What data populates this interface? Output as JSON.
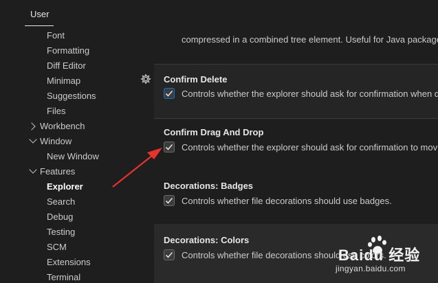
{
  "tab": {
    "label": "User"
  },
  "sidebar": {
    "items": [
      {
        "label": "Font"
      },
      {
        "label": "Formatting"
      },
      {
        "label": "Diff Editor"
      },
      {
        "label": "Minimap"
      },
      {
        "label": "Suggestions"
      },
      {
        "label": "Files"
      },
      {
        "label": "Workbench",
        "expandable": true,
        "expanded": false
      },
      {
        "label": "Window",
        "expandable": true,
        "expanded": true
      },
      {
        "label": "New Window"
      },
      {
        "label": "Features",
        "expandable": true,
        "expanded": true
      },
      {
        "label": "Explorer",
        "selected": true
      },
      {
        "label": "Search"
      },
      {
        "label": "Debug"
      },
      {
        "label": "Testing"
      },
      {
        "label": "SCM"
      },
      {
        "label": "Extensions"
      },
      {
        "label": "Terminal"
      }
    ]
  },
  "main": {
    "top_description": "compressed in a combined tree element. Useful for Java package",
    "settings": [
      {
        "category": "",
        "title": "Confirm Delete",
        "checked": true,
        "description": "Controls whether the explorer should ask for confirmation when d"
      },
      {
        "category": "",
        "title": "Confirm Drag And Drop",
        "checked": true,
        "description": "Controls whether the explorer should ask for confirmation to mov"
      },
      {
        "category": "Decorations: ",
        "title": "Badges",
        "checked": true,
        "description": "Controls whether file decorations should use badges."
      },
      {
        "category": "Decorations: ",
        "title": "Colors",
        "checked": true,
        "description": "Controls whether file decorations should use colors."
      }
    ]
  },
  "watermark": {
    "brand": "Baidu 经验",
    "url": "jingyan.baidu.com"
  },
  "colors": {
    "background": "#1e1e1e",
    "focus_border": "#0078d4",
    "annotation_arrow": "#e8332b"
  }
}
